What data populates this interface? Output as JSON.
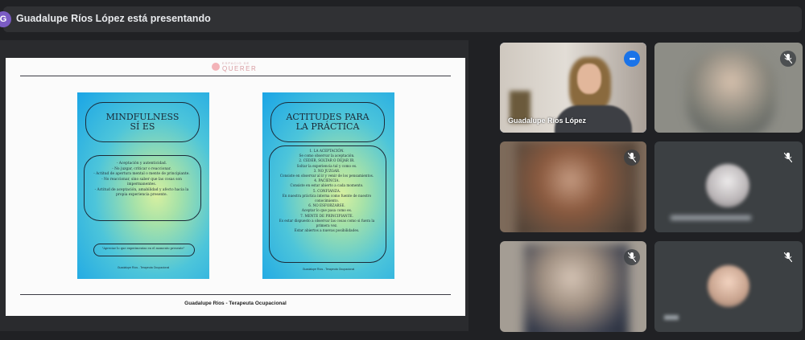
{
  "header": {
    "presenter_initial": "G",
    "title": "Guadalupe Ríos López está presentando"
  },
  "slide": {
    "logo_small": "ESPACIO DE",
    "logo_name": "QUERER",
    "card_left": {
      "heading": "MINDFULNESS\nSÍ ES",
      "body": "- Aceptación y autenticidad.\n- No juzgar, criticar o reaccionar.\n- Actitud de apertura mental o mente de principiante.\n- No reaccionar, sino saber que las cosas son impermanentes.\n- Actitud de aceptación, amabilidad y afecto hacia la propia experiencia presente.",
      "quote": "\"Apreciar lo que experimentas en el momento presente\"",
      "footer": "Guadalupe Ríos - Terapeuta Ocupacional"
    },
    "card_right": {
      "heading": "ACTITUDES PARA\nLA PRÁCTICA",
      "body": "1. LA ACEPTACIÓN.\nSe como observar la aceptación.\n2. CEDER, SOLTAR O DEJAR IR.\nSoltar la experiencia tal y como es.\n3. NO JUZGAR.\nConsiste en observar al ir y venir de los pensamientos.\n4. PACIENCIA.\nConsiste en estar abierto a cada momento.\n5. CONFIANZA.\nEn nuestra práctica interna como fuente de nuestro conocimiento.\n6. NO ESFORZARSE.\nAceptar lo que pasa como es.\n7. MENTE DE PRINCIPIANTE.\nEs estar dispuesto a observar las cosas como si fuera la primera vez.\nEstar abiertos a nuevas posibilidades.",
      "footer": "Guadalupe Ríos - Terapeuta Ocupacional"
    },
    "caption": "Guadalupe Ríos - Terapeuta Ocupacional"
  },
  "participants": [
    {
      "name": "Guadalupe Ríos López",
      "state": "speaking"
    },
    {
      "name": "",
      "state": "muted"
    },
    {
      "name": "",
      "state": "muted"
    },
    {
      "name": "",
      "state": "muted"
    },
    {
      "name": "",
      "state": "muted"
    },
    {
      "name": "",
      "state": "muted"
    }
  ],
  "icons": {
    "more": "more-options-icon",
    "mic_off": "mic-off-icon"
  },
  "colors": {
    "background": "#202124",
    "accent": "#1a73e8",
    "tile_border_active": "#8ab4f8"
  }
}
